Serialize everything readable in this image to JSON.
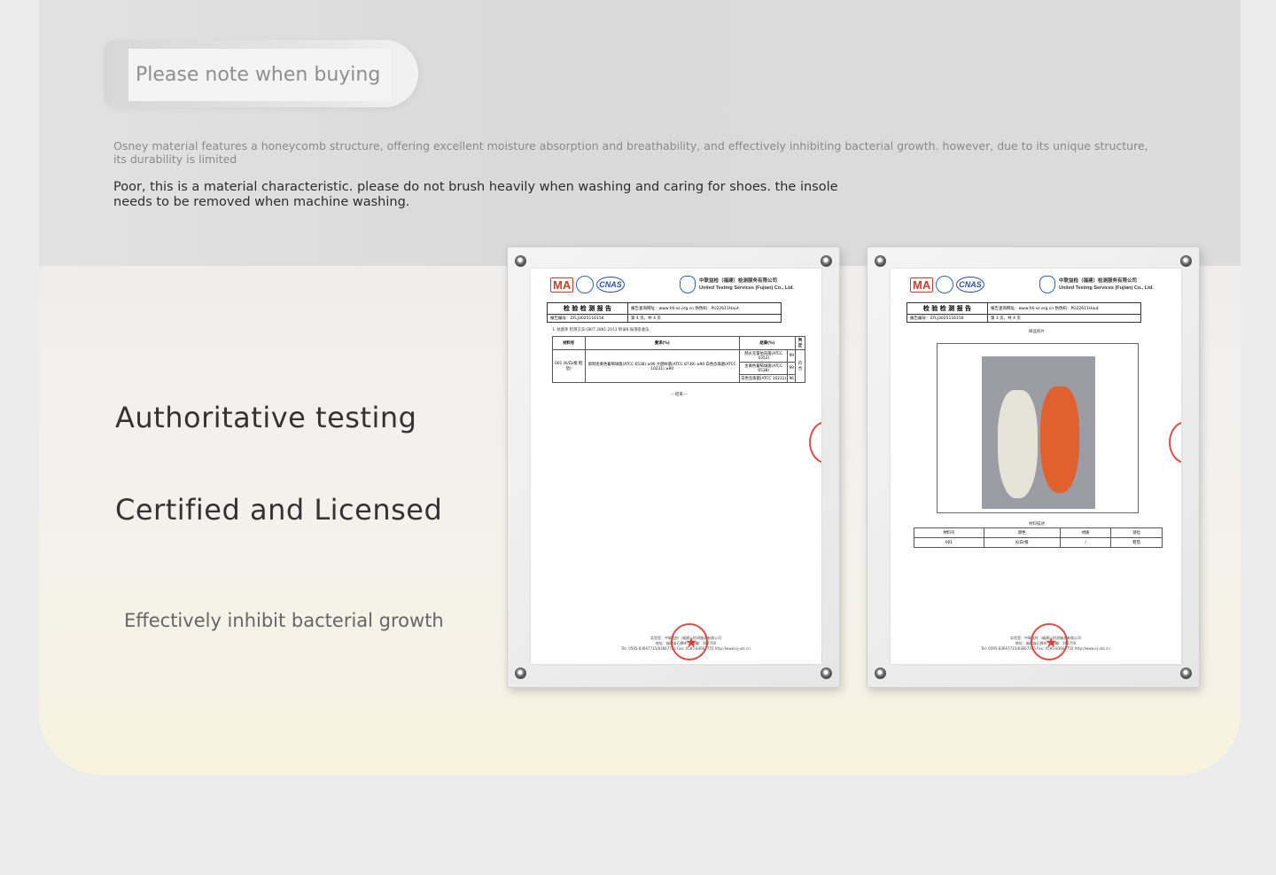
{
  "notice": {
    "title": "Please note when buying"
  },
  "description": {
    "line1": "Osney material features a honeycomb structure, offering excellent moisture absorption and breathability, and effectively inhibiting bacterial growth. however, due to its unique structure, its durability is limited",
    "line2": "Poor, this is a material characteristic. please do not brush heavily when washing and caring for shoes. the insole needs to be removed when machine washing."
  },
  "headlines": {
    "testing": "Authoritative testing",
    "certified": "Certified and Licensed",
    "benefit": "Effectively inhibit bacterial growth"
  },
  "certificates": {
    "org_cn": "中联益检（福建）检测服务有限公司",
    "org_en": "United Testing Services (Fujian) Co., Ltd.",
    "report_title": "检 验 检 测 报 告",
    "report_no": "报告编号：ZFLJ3025116156",
    "query_site": "报告查询网址：www.fdi-sz.org.cn",
    "query_code": "防伪码：PU22611Haut",
    "doc1": {
      "page": "第 4 页，共 4 页",
      "section": "1. 抗菌率 检测方法:QB/T 2881-2013 附录B 振荡吸收法",
      "headers": [
        "材料号",
        "要求(%)",
        "结果(%)",
        "判定"
      ],
      "sample": "001 (K/白/橙 鞋垫)",
      "requirements": "抑制金黄色葡萄球菌(ATCC 6538) ≥90 大肠杆菌(ATCC 8739) ≥90 白色念珠菌(ATCC 10231) ≥90",
      "results": [
        {
          "organism": "肺炎克雷伯氏菌(ATCC 4352)",
          "value": "99"
        },
        {
          "organism": "金黄色葡萄球菌(ATCC 6538)",
          "value": "99"
        },
        {
          "organism": "白色念珠菌(ATCC 10231)",
          "value": "96"
        }
      ],
      "verdict": "符合",
      "end": "---结束---"
    },
    "doc2": {
      "page": "第 3 页，共 4 页",
      "photo_caption": "样品照片",
      "material_caption": "材料描述",
      "headers": [
        "材料号",
        "颜色",
        "材质",
        "部位"
      ],
      "row": [
        "001",
        "K/白/橙",
        "/",
        "鞋垫"
      ]
    },
    "footer_lab": "实验室：中联益检（福建）检测服务有限公司",
    "footer_addr": "地址：福建省石狮市... 邮编：362700",
    "footer_tel": "Tel: 0595-83667715/83667725   Fax: 0595-83667755   http://www.cj-uts.cn"
  }
}
